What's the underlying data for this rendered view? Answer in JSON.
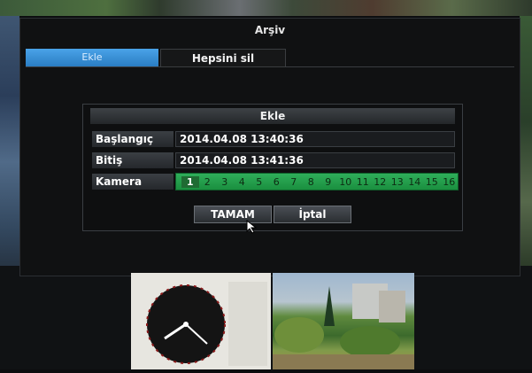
{
  "window": {
    "title": "Arşiv"
  },
  "tabs": {
    "add_label": "Ekle",
    "delete_all_label": "Hepsini sil"
  },
  "dialog": {
    "title": "Ekle",
    "start_label": "Başlangıç",
    "start_value": "2014.04.08   13:40:36",
    "end_label": "Bitiş",
    "end_value": "2014.04.08   13:41:36",
    "camera_label": "Kamera",
    "cameras": [
      "1",
      "2",
      "3",
      "4",
      "5",
      "6",
      "7",
      "8",
      "9",
      "10",
      "11",
      "12",
      "13",
      "14",
      "15",
      "16"
    ],
    "selected_camera": "1",
    "ok_label": "TAMAM",
    "cancel_label": "İptal"
  },
  "colors": {
    "accent": "#2a7dc3",
    "camera_bar": "#1a8f3f"
  },
  "icons": {
    "cursor": "mouse-pointer-icon"
  }
}
